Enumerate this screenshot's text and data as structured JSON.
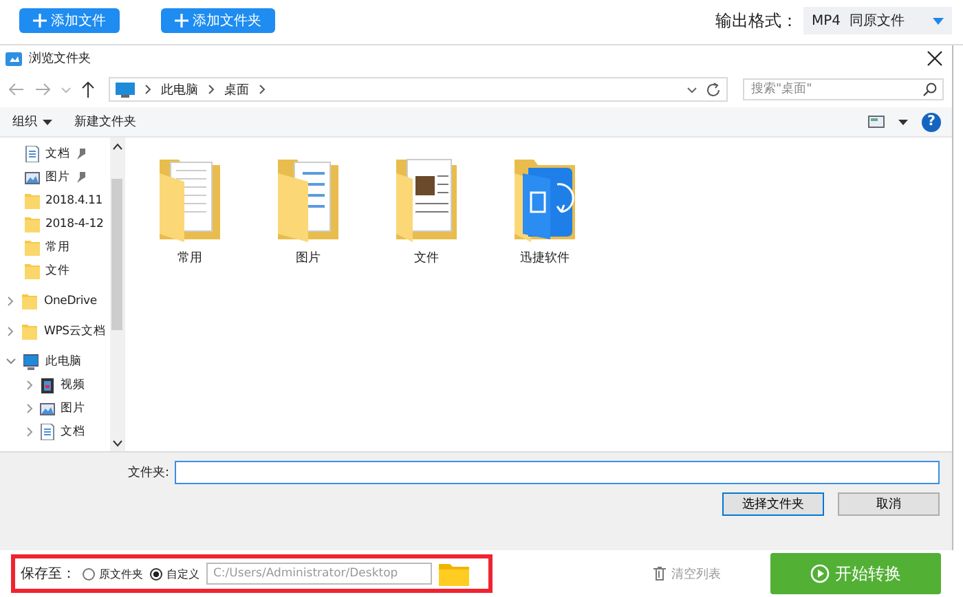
{
  "app_toolbar": {
    "buttons": [
      {
        "label": "添加文件"
      },
      {
        "label": "添加文件夹"
      }
    ],
    "output_format": {
      "label": "输出格式：",
      "value": "MP4  同原文件"
    }
  },
  "dialog": {
    "title": "浏览文件夹",
    "breadcrumb": [
      "此电脑",
      "桌面"
    ],
    "search": {
      "placeholder": "搜索\"桌面\""
    },
    "toolbar": {
      "organize": "组织",
      "new_folder": "新建文件夹",
      "help": "?"
    },
    "sidebar": {
      "quick_access": [
        {
          "label": "文档",
          "kind": "document",
          "pinned": true
        },
        {
          "label": "图片",
          "kind": "picture",
          "pinned": true
        },
        {
          "label": "2018.4.11",
          "kind": "folder",
          "pinned": false
        },
        {
          "label": "2018-4-12",
          "kind": "folder",
          "pinned": false
        },
        {
          "label": "常用",
          "kind": "folder",
          "pinned": false
        },
        {
          "label": "文件",
          "kind": "folder",
          "pinned": false
        }
      ],
      "tree": [
        {
          "label": "OneDrive",
          "kind": "folder",
          "expanded": false
        },
        {
          "label": "WPS云文档",
          "kind": "folder",
          "expanded": false
        },
        {
          "label": "此电脑",
          "kind": "pc",
          "expanded": true,
          "children": [
            {
              "label": "视频",
              "kind": "video",
              "expanded": false
            },
            {
              "label": "图片",
              "kind": "picture",
              "expanded": false
            },
            {
              "label": "文档",
              "kind": "document",
              "expanded": false
            }
          ]
        }
      ]
    },
    "folders": [
      {
        "label": "常用",
        "kind": "pages"
      },
      {
        "label": "图片",
        "kind": "blue-pages"
      },
      {
        "label": "文件",
        "kind": "photo"
      },
      {
        "label": "迅捷软件",
        "kind": "app"
      }
    ],
    "folder_field": {
      "label": "文件夹:"
    },
    "buttons": [
      {
        "label": "选择文件夹",
        "default": true
      },
      {
        "label": "取消",
        "default": false
      }
    ]
  },
  "save_bar": {
    "label": "保存至：",
    "options": [
      {
        "label": "原文件夹",
        "selected": false
      },
      {
        "label": "自定义",
        "selected": true
      }
    ],
    "path": "C:/Users/Administrator/Desktop",
    "clear_button": "清空列表",
    "start_button": "开始转换"
  }
}
